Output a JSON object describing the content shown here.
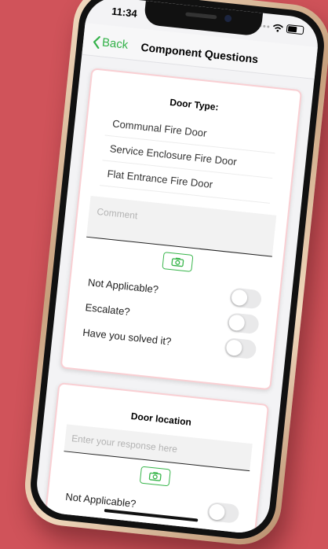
{
  "status": {
    "time": "11:34"
  },
  "nav": {
    "back_label": "Back",
    "title": "Component Questions"
  },
  "card1": {
    "title": "Door Type:",
    "options": [
      "Communal Fire Door",
      "Service Enclosure Fire Door",
      "Flat Entrance Fire Door"
    ],
    "comment_placeholder": "Comment",
    "toggles": [
      {
        "label": "Not Applicable?",
        "on": false
      },
      {
        "label": "Escalate?",
        "on": false
      },
      {
        "label": "Have you solved it?",
        "on": false
      }
    ]
  },
  "card2": {
    "title": "Door location",
    "response_placeholder": "Enter your response here",
    "toggles": [
      {
        "label": "Not Applicable?",
        "on": false
      }
    ]
  },
  "colors": {
    "background": "#d0535a",
    "accent": "#34b24a",
    "card_border": "#f9cfd3"
  },
  "icons": {
    "back": "chevron-left-icon",
    "camera": "camera-icon"
  }
}
